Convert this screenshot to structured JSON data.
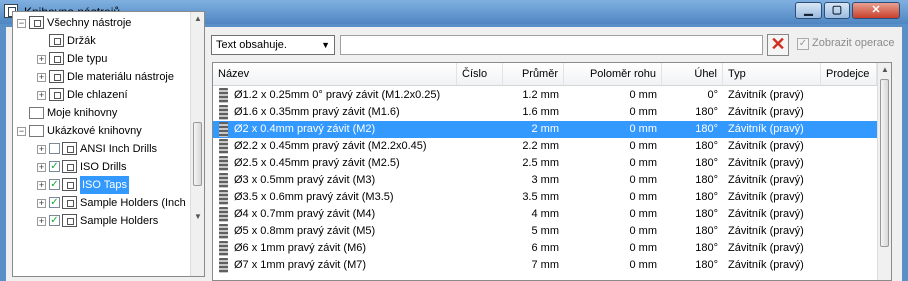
{
  "window": {
    "title": "Knihovna nástrojů"
  },
  "tree": [
    {
      "label": "Všechny nástroje",
      "level": 0,
      "expander": "minus",
      "icon": "tool-library-icon",
      "checkbox": null,
      "selected": false
    },
    {
      "label": "Držák",
      "level": 1,
      "expander": null,
      "icon": "tool-library-icon",
      "checkbox": null,
      "selected": false
    },
    {
      "label": "Dle typu",
      "level": 1,
      "expander": "plus",
      "icon": "tool-library-icon",
      "checkbox": null,
      "selected": false
    },
    {
      "label": "Dle materiálu nástroje",
      "level": 1,
      "expander": "plus",
      "icon": "tool-library-icon",
      "checkbox": null,
      "selected": false
    },
    {
      "label": "Dle chlazení",
      "level": 1,
      "expander": "plus",
      "icon": "tool-library-icon",
      "checkbox": null,
      "selected": false
    },
    {
      "label": "Moje knihovny",
      "level": 0,
      "expander": null,
      "icon": "folder-icon",
      "checkbox": null,
      "selected": false
    },
    {
      "label": "Ukázkové knihovny",
      "level": 0,
      "expander": "minus",
      "icon": "folder-icon",
      "checkbox": null,
      "selected": false
    },
    {
      "label": "ANSI Inch Drills",
      "level": 1,
      "expander": "plus",
      "icon": "tool-library-icon",
      "checkbox": false,
      "selected": false
    },
    {
      "label": "ISO Drills",
      "level": 1,
      "expander": "plus",
      "icon": "tool-library-icon",
      "checkbox": true,
      "selected": false
    },
    {
      "label": "ISO Taps",
      "level": 1,
      "expander": "plus",
      "icon": "tool-library-icon",
      "checkbox": true,
      "selected": true
    },
    {
      "label": "Sample Holders (Inch",
      "level": 1,
      "expander": "plus",
      "icon": "tool-library-icon",
      "checkbox": true,
      "selected": false
    },
    {
      "label": "Sample Holders",
      "level": 1,
      "expander": "plus",
      "icon": "tool-library-icon",
      "checkbox": true,
      "selected": false
    }
  ],
  "filter": {
    "mode_label": "Text obsahuje.",
    "search_value": "",
    "show_operations_label": "Zobrazit operace",
    "show_operations_checked": true
  },
  "table": {
    "columns": [
      "Název",
      "Číslo",
      "Průměr",
      "Poloměr rohu",
      "Úhel",
      "Typ",
      "Prodejce"
    ],
    "rows": [
      {
        "name": "Ø1.2 x 0.25mm 0° pravý závit (M1.2x0.25)",
        "number": "",
        "diameter": "1.2 mm",
        "corner_radius": "0 mm",
        "angle": "0°",
        "type": "Závitník (pravý)",
        "vendor": "",
        "selected": false
      },
      {
        "name": "Ø1.6 x 0.35mm pravý závit (M1.6)",
        "number": "",
        "diameter": "1.6 mm",
        "corner_radius": "0 mm",
        "angle": "180°",
        "type": "Závitník (pravý)",
        "vendor": "",
        "selected": false
      },
      {
        "name": "Ø2 x 0.4mm pravý závit (M2)",
        "number": "",
        "diameter": "2 mm",
        "corner_radius": "0 mm",
        "angle": "180°",
        "type": "Závitník (pravý)",
        "vendor": "",
        "selected": true
      },
      {
        "name": "Ø2.2 x 0.45mm pravý závit (M2.2x0.45)",
        "number": "",
        "diameter": "2.2 mm",
        "corner_radius": "0 mm",
        "angle": "180°",
        "type": "Závitník (pravý)",
        "vendor": "",
        "selected": false
      },
      {
        "name": "Ø2.5 x 0.45mm pravý závit (M2.5)",
        "number": "",
        "diameter": "2.5 mm",
        "corner_radius": "0 mm",
        "angle": "180°",
        "type": "Závitník (pravý)",
        "vendor": "",
        "selected": false
      },
      {
        "name": "Ø3 x 0.5mm pravý závit (M3)",
        "number": "",
        "diameter": "3 mm",
        "corner_radius": "0 mm",
        "angle": "180°",
        "type": "Závitník (pravý)",
        "vendor": "",
        "selected": false
      },
      {
        "name": "Ø3.5 x 0.6mm pravý závit (M3.5)",
        "number": "",
        "diameter": "3.5 mm",
        "corner_radius": "0 mm",
        "angle": "180°",
        "type": "Závitník (pravý)",
        "vendor": "",
        "selected": false
      },
      {
        "name": "Ø4 x 0.7mm pravý závit (M4)",
        "number": "",
        "diameter": "4 mm",
        "corner_radius": "0 mm",
        "angle": "180°",
        "type": "Závitník (pravý)",
        "vendor": "",
        "selected": false
      },
      {
        "name": "Ø5 x 0.8mm pravý závit (M5)",
        "number": "",
        "diameter": "5 mm",
        "corner_radius": "0 mm",
        "angle": "180°",
        "type": "Závitník (pravý)",
        "vendor": "",
        "selected": false
      },
      {
        "name": "Ø6 x 1mm pravý závit (M6)",
        "number": "",
        "diameter": "6 mm",
        "corner_radius": "0 mm",
        "angle": "180°",
        "type": "Závitník (pravý)",
        "vendor": "",
        "selected": false
      },
      {
        "name": "Ø7 x 1mm pravý závit (M7)",
        "number": "",
        "diameter": "7 mm",
        "corner_radius": "0 mm",
        "angle": "180°",
        "type": "Závitník (pravý)",
        "vendor": "",
        "selected": false
      }
    ]
  },
  "colors": {
    "selection": "#3399ff",
    "titlebar": "#5a8fc7",
    "close_button": "#c8402c"
  }
}
